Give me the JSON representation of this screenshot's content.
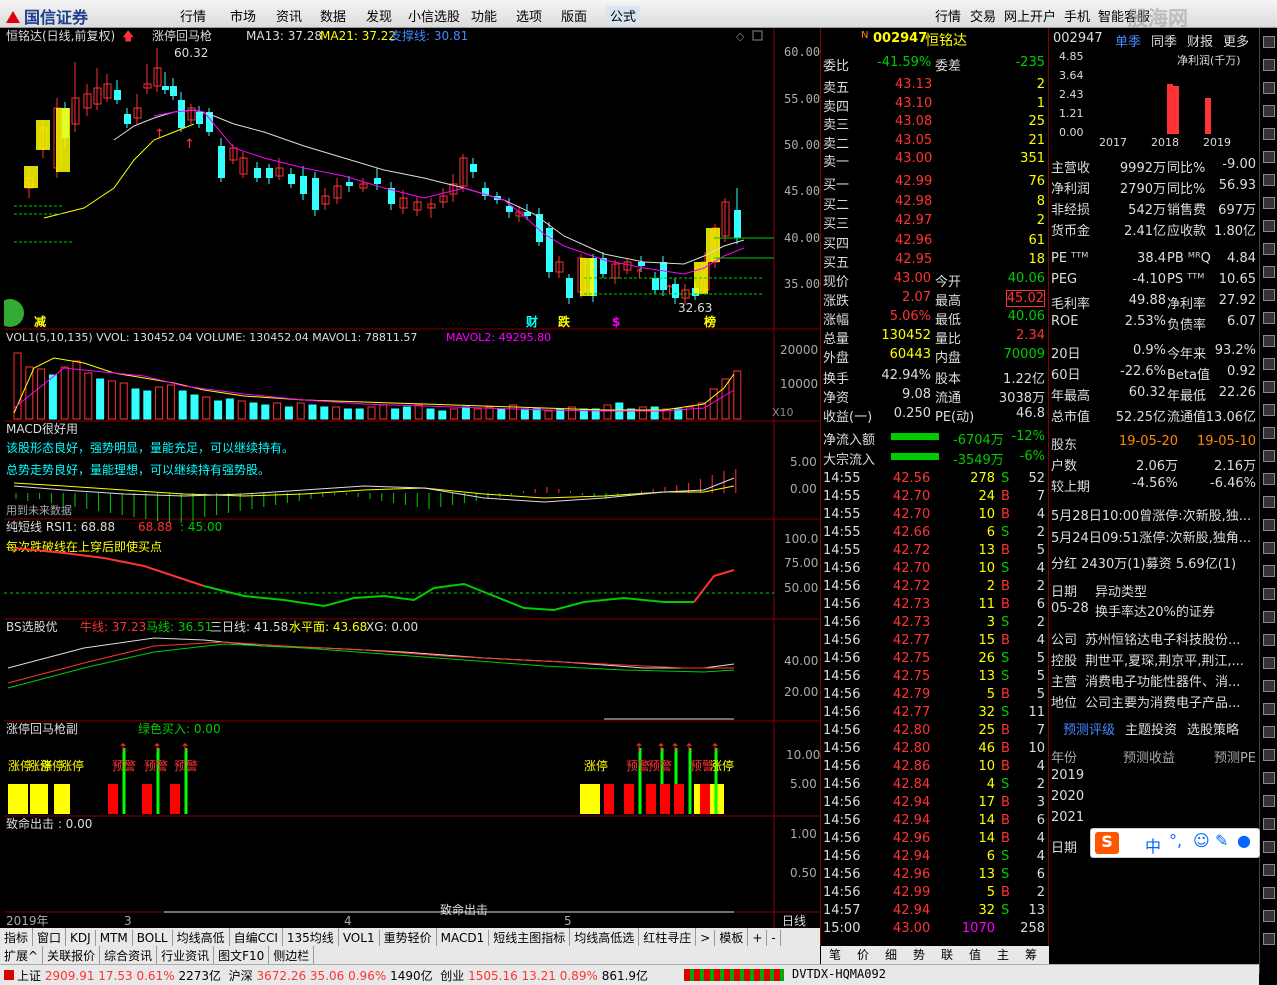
{
  "menubar": {
    "logo": "国信证券",
    "items": [
      "行情",
      "市场",
      "资讯",
      "数据",
      "发现",
      "小信选股",
      "功能",
      "选项",
      "版面",
      "公式"
    ],
    "right_items": [
      "行情",
      "交易",
      "网上开户",
      "手机",
      "智能客服"
    ],
    "watermark": "股海网"
  },
  "chart": {
    "title": "恒铭达(日线,前复权)",
    "indicator": "涨停回马枪",
    "ma13": "MA13: 37.28",
    "ma21": "MA21: 37.22",
    "support": "支撑线: 30.81",
    "high_label": "60.32",
    "low_label": "32.63",
    "price_axis": [
      "60.00",
      "55.00",
      "50.00",
      "45.00",
      "40.00",
      "35.00"
    ],
    "bottom_marks": [
      "减",
      "财",
      "跌",
      "$",
      "榜"
    ],
    "vol_title": "VOL1(5,10,135)  VVOL: 130452.04  VOLUME: 130452.04  MAVOL1: 78811.57",
    "vol_mavol2": "MAVOL2: 49295.80",
    "vol_axis": [
      "20000",
      "10000",
      "X10"
    ],
    "macd_title": "MACD很好用",
    "macd_text1": "该股形态良好，强势明显，量能充足，可以继续持有。",
    "macd_text2": "总势走势良好，量能理想，可以继续持有强势股。",
    "macd_text3": "用到未来数据",
    "macd_axis": [
      "5.00",
      "0.00"
    ],
    "rsi_title": "纯短线 RSI1: 68.88",
    "rsi_v2": "68.88",
    "rsi_v3": ": 45.00",
    "rsi_note": "每次跌破线在上穿后即使买点",
    "rsi_axis": [
      "100.0",
      "75.00",
      "50.00"
    ],
    "bs_title": "BS选股优",
    "bs_niu": "牛线: 37.23",
    "bs_ma": "马线: 36.51",
    "bs_san": "三日线: 41.58",
    "bs_sp": "水平面: 43.68",
    "bs_xg": "XG: 0.00",
    "bs_axis": [
      "40.00",
      "20.00"
    ],
    "zt_title": "涨停回马枪副",
    "zt_buy": "绿色买入: 0.00",
    "zt_axis": [
      "10.00",
      "5.00"
    ],
    "zt_labels": [
      "涨停",
      "涨停",
      "涨停",
      "涨停",
      "预警",
      "预警",
      "预警",
      "涨停",
      "预警",
      "预警",
      "预警",
      "涨停"
    ],
    "zm_title": "致命出击 : 0.00",
    "zm_axis": [
      "1.00",
      "0.50"
    ],
    "zm_label": "致命出击",
    "date_axis": [
      "2019年",
      "3",
      "4",
      "5"
    ],
    "date_right": "日线"
  },
  "bottom_tabs": [
    "指标",
    "窗口",
    "KDJ",
    "MTM",
    "BOLL",
    "均线高低",
    "自编CCI",
    "135均线",
    "VOL1",
    "重势轻价",
    "MACD1",
    "短线主图指标",
    "均线高低选",
    "红柱寻庄",
    ">",
    "模板",
    "+",
    "-"
  ],
  "bottom_tabs2": [
    "扩展^",
    "关联报价",
    "综合资讯",
    "行业资讯",
    "图文F10",
    "侧边栏"
  ],
  "quote": {
    "code": "002947",
    "name": "恒铭达",
    "weibi_label": "委比",
    "weibi": "-41.59%",
    "weicha_label": "委差",
    "weicha": "-235",
    "sells": [
      {
        "label": "卖五",
        "price": "43.13",
        "vol": "2"
      },
      {
        "label": "卖四",
        "price": "43.10",
        "vol": "1"
      },
      {
        "label": "卖三",
        "price": "43.08",
        "vol": "25"
      },
      {
        "label": "卖二",
        "price": "43.05",
        "vol": "21"
      },
      {
        "label": "卖一",
        "price": "43.00",
        "vol": "351"
      }
    ],
    "buys": [
      {
        "label": "买一",
        "price": "42.99",
        "vol": "76"
      },
      {
        "label": "买二",
        "price": "42.98",
        "vol": "8"
      },
      {
        "label": "买三",
        "price": "42.97",
        "vol": "2"
      },
      {
        "label": "买四",
        "price": "42.96",
        "vol": "61"
      },
      {
        "label": "买五",
        "price": "42.95",
        "vol": "18"
      }
    ],
    "stats": [
      {
        "l1": "现价",
        "v1": "43.00",
        "l2": "今开",
        "v2": "40.06"
      },
      {
        "l1": "涨跌",
        "v1": "2.07",
        "l2": "最高",
        "v2": "45.02"
      },
      {
        "l1": "涨幅",
        "v1": "5.06%",
        "l2": "最低",
        "v2": "40.06"
      },
      {
        "l1": "总量",
        "v1": "130452",
        "l2": "量比",
        "v2": "2.34"
      },
      {
        "l1": "外盘",
        "v1": "60443",
        "l2": "内盘",
        "v2": "70009"
      }
    ],
    "stats2": [
      {
        "l1": "换手",
        "v1": "42.94%",
        "l2": "股本",
        "v2": "1.22亿"
      },
      {
        "l1": "净资",
        "v1": "9.08",
        "l2": "流通",
        "v2": "3038万"
      },
      {
        "l1": "收益(一)",
        "v1": "0.250",
        "l2": "PE(动)",
        "v2": "46.8"
      }
    ],
    "flow": [
      {
        "label": "净流入额",
        "val": "-6704万",
        "pct": "-12%"
      },
      {
        "label": "大宗流入",
        "val": "-3549万",
        "pct": "-6%"
      }
    ],
    "ticks": [
      {
        "t": "14:55",
        "p": "42.56",
        "v": "278",
        "s": "S",
        "n": "52"
      },
      {
        "t": "14:55",
        "p": "42.70",
        "v": "24",
        "s": "B",
        "n": "7"
      },
      {
        "t": "14:55",
        "p": "42.70",
        "v": "10",
        "s": "B",
        "n": "4"
      },
      {
        "t": "14:55",
        "p": "42.66",
        "v": "6",
        "s": "S",
        "n": "2"
      },
      {
        "t": "14:55",
        "p": "42.72",
        "v": "13",
        "s": "B",
        "n": "5"
      },
      {
        "t": "14:56",
        "p": "42.70",
        "v": "10",
        "s": "S",
        "n": "4"
      },
      {
        "t": "14:56",
        "p": "42.72",
        "v": "2",
        "s": "B",
        "n": "2"
      },
      {
        "t": "14:56",
        "p": "42.73",
        "v": "11",
        "s": "B",
        "n": "6"
      },
      {
        "t": "14:56",
        "p": "42.73",
        "v": "3",
        "s": "S",
        "n": "2"
      },
      {
        "t": "14:56",
        "p": "42.77",
        "v": "15",
        "s": "B",
        "n": "4"
      },
      {
        "t": "14:56",
        "p": "42.75",
        "v": "26",
        "s": "S",
        "n": "5"
      },
      {
        "t": "14:56",
        "p": "42.75",
        "v": "13",
        "s": "S",
        "n": "5"
      },
      {
        "t": "14:56",
        "p": "42.79",
        "v": "5",
        "s": "B",
        "n": "5"
      },
      {
        "t": "14:56",
        "p": "42.77",
        "v": "32",
        "s": "S",
        "n": "11"
      },
      {
        "t": "14:56",
        "p": "42.80",
        "v": "25",
        "s": "B",
        "n": "7"
      },
      {
        "t": "14:56",
        "p": "42.80",
        "v": "46",
        "s": "B",
        "n": "10"
      },
      {
        "t": "14:56",
        "p": "42.86",
        "v": "10",
        "s": "B",
        "n": "4"
      },
      {
        "t": "14:56",
        "p": "42.84",
        "v": "4",
        "s": "S",
        "n": "2"
      },
      {
        "t": "14:56",
        "p": "42.94",
        "v": "17",
        "s": "B",
        "n": "3"
      },
      {
        "t": "14:56",
        "p": "42.94",
        "v": "14",
        "s": "B",
        "n": "6"
      },
      {
        "t": "14:56",
        "p": "42.96",
        "v": "14",
        "s": "B",
        "n": "4"
      },
      {
        "t": "14:56",
        "p": "42.94",
        "v": "6",
        "s": "S",
        "n": "4"
      },
      {
        "t": "14:56",
        "p": "42.96",
        "v": "13",
        "s": "S",
        "n": "6"
      },
      {
        "t": "14:56",
        "p": "42.99",
        "v": "5",
        "s": "B",
        "n": "2"
      },
      {
        "t": "14:57",
        "p": "42.94",
        "v": "32",
        "s": "S",
        "n": "13"
      },
      {
        "t": "15:00",
        "p": "43.00",
        "v": "1070",
        "s": "",
        "n": "258"
      }
    ],
    "tabs": [
      "笔",
      "价",
      "细",
      "势",
      "联",
      "值",
      "主",
      "筹"
    ]
  },
  "f10": {
    "code": "002947",
    "tabs": [
      "单季",
      "同季",
      "财报",
      "更多"
    ],
    "chart_ylabels": [
      "4.85",
      "3.64",
      "2.43",
      "1.21",
      "0.00"
    ],
    "chart_title": "净利润(千万)",
    "chart_years": [
      "2017",
      "2018",
      "2019"
    ],
    "rows": [
      {
        "l1": "主营收",
        "v1": "9992万",
        "l2": "同比%",
        "v2": "-9.00"
      },
      {
        "l1": "净利润",
        "v1": "2790万",
        "l2": "同比%",
        "v2": "56.93"
      },
      {
        "l1": "非经损",
        "v1": "542万",
        "l2": "销售费",
        "v2": "697万"
      },
      {
        "l1": "货币金",
        "v1": "2.41亿",
        "l2": "应收款",
        "v2": "1.80亿"
      }
    ],
    "val_rows": [
      {
        "l1": "PE ᵀᵀᴹ",
        "v1": "38.4",
        "l2": "PB ᴹᴿQ",
        "v2": "4.84"
      },
      {
        "l1": "PEG",
        "v1": "-4.10",
        "l2": "PS ᵀᵀᴹ",
        "v2": "10.65"
      },
      {
        "l1": "毛利率",
        "v1": "49.88",
        "l2": "净利率",
        "v2": "27.92"
      },
      {
        "l1": "ROE",
        "v1": "2.53%",
        "l2": "负债率",
        "v2": "6.07"
      }
    ],
    "perf_rows": [
      {
        "l1": "20日",
        "v1": "0.9%",
        "l2": "今年来",
        "v2": "93.2%"
      },
      {
        "l1": "60日",
        "v1": "-22.6%",
        "l2": "Beta值",
        "v2": "0.92"
      },
      {
        "l1": "年最高",
        "v1": "60.32",
        "l2": "年最低",
        "v2": "22.26"
      },
      {
        "l1": "总市值",
        "v1": "52.25亿",
        "l2": "流通值",
        "v2": "13.06亿"
      }
    ],
    "holders_label": "股东",
    "holders_d1": "19-05-20",
    "holders_d2": "19-05-10",
    "holders_rows": [
      {
        "l": "户数",
        "a": "2.06万",
        "b": "2.16万"
      },
      {
        "l": "较上期",
        "a": "-4.56%",
        "b": "-6.46%"
      }
    ],
    "news": [
      "5月28日10:00曾涨停:次新股,独...",
      "5月24日09:51涨停:次新股,独角..."
    ],
    "fenhong": "分红  2430万(1)募资  5.69亿(1)",
    "abn_h1": "日期",
    "abn_h2": "异动类型",
    "abn_date": "05-28",
    "abn_type": "换手率达20%的证券",
    "company": [
      {
        "l": "公司",
        "v": "苏州恒铭达电子科技股份..."
      },
      {
        "l": "控股",
        "v": "荆世平,夏琛,荆京平,荆江,..."
      },
      {
        "l": "主营",
        "v": "消费电子功能性器件、消..."
      },
      {
        "l": "地位",
        "v": "公司主要为消费电子产品..."
      }
    ],
    "ratings_tabs": [
      "预测评级",
      "主题投资",
      "选股策略"
    ],
    "forecast_h": [
      "年份",
      "预测收益",
      "预测PE"
    ],
    "forecast_years": [
      "2019",
      "2020",
      "2021"
    ],
    "date_label": "日期"
  },
  "ime": {
    "label": "中"
  },
  "statusbar": {
    "sh_label": "上证",
    "sh": "2909.91",
    "sh_chg": "17.53",
    "sh_pct": "0.61%",
    "sh_amt": "2273亿",
    "sz_label": "沪深",
    "sz": "3672.26",
    "sz_chg": "35.06",
    "sz_pct": "0.96%",
    "sz_amt": "1490亿",
    "cy_label": "创业",
    "cy": "1505.16",
    "cy_chg": "13.21",
    "cy_pct": "0.89%",
    "cy_amt": "861.9亿",
    "server": "DVTDX-HQMA092"
  },
  "colors": {
    "up": "#ff3333",
    "down": "#33ffff",
    "bg": "#000000"
  }
}
